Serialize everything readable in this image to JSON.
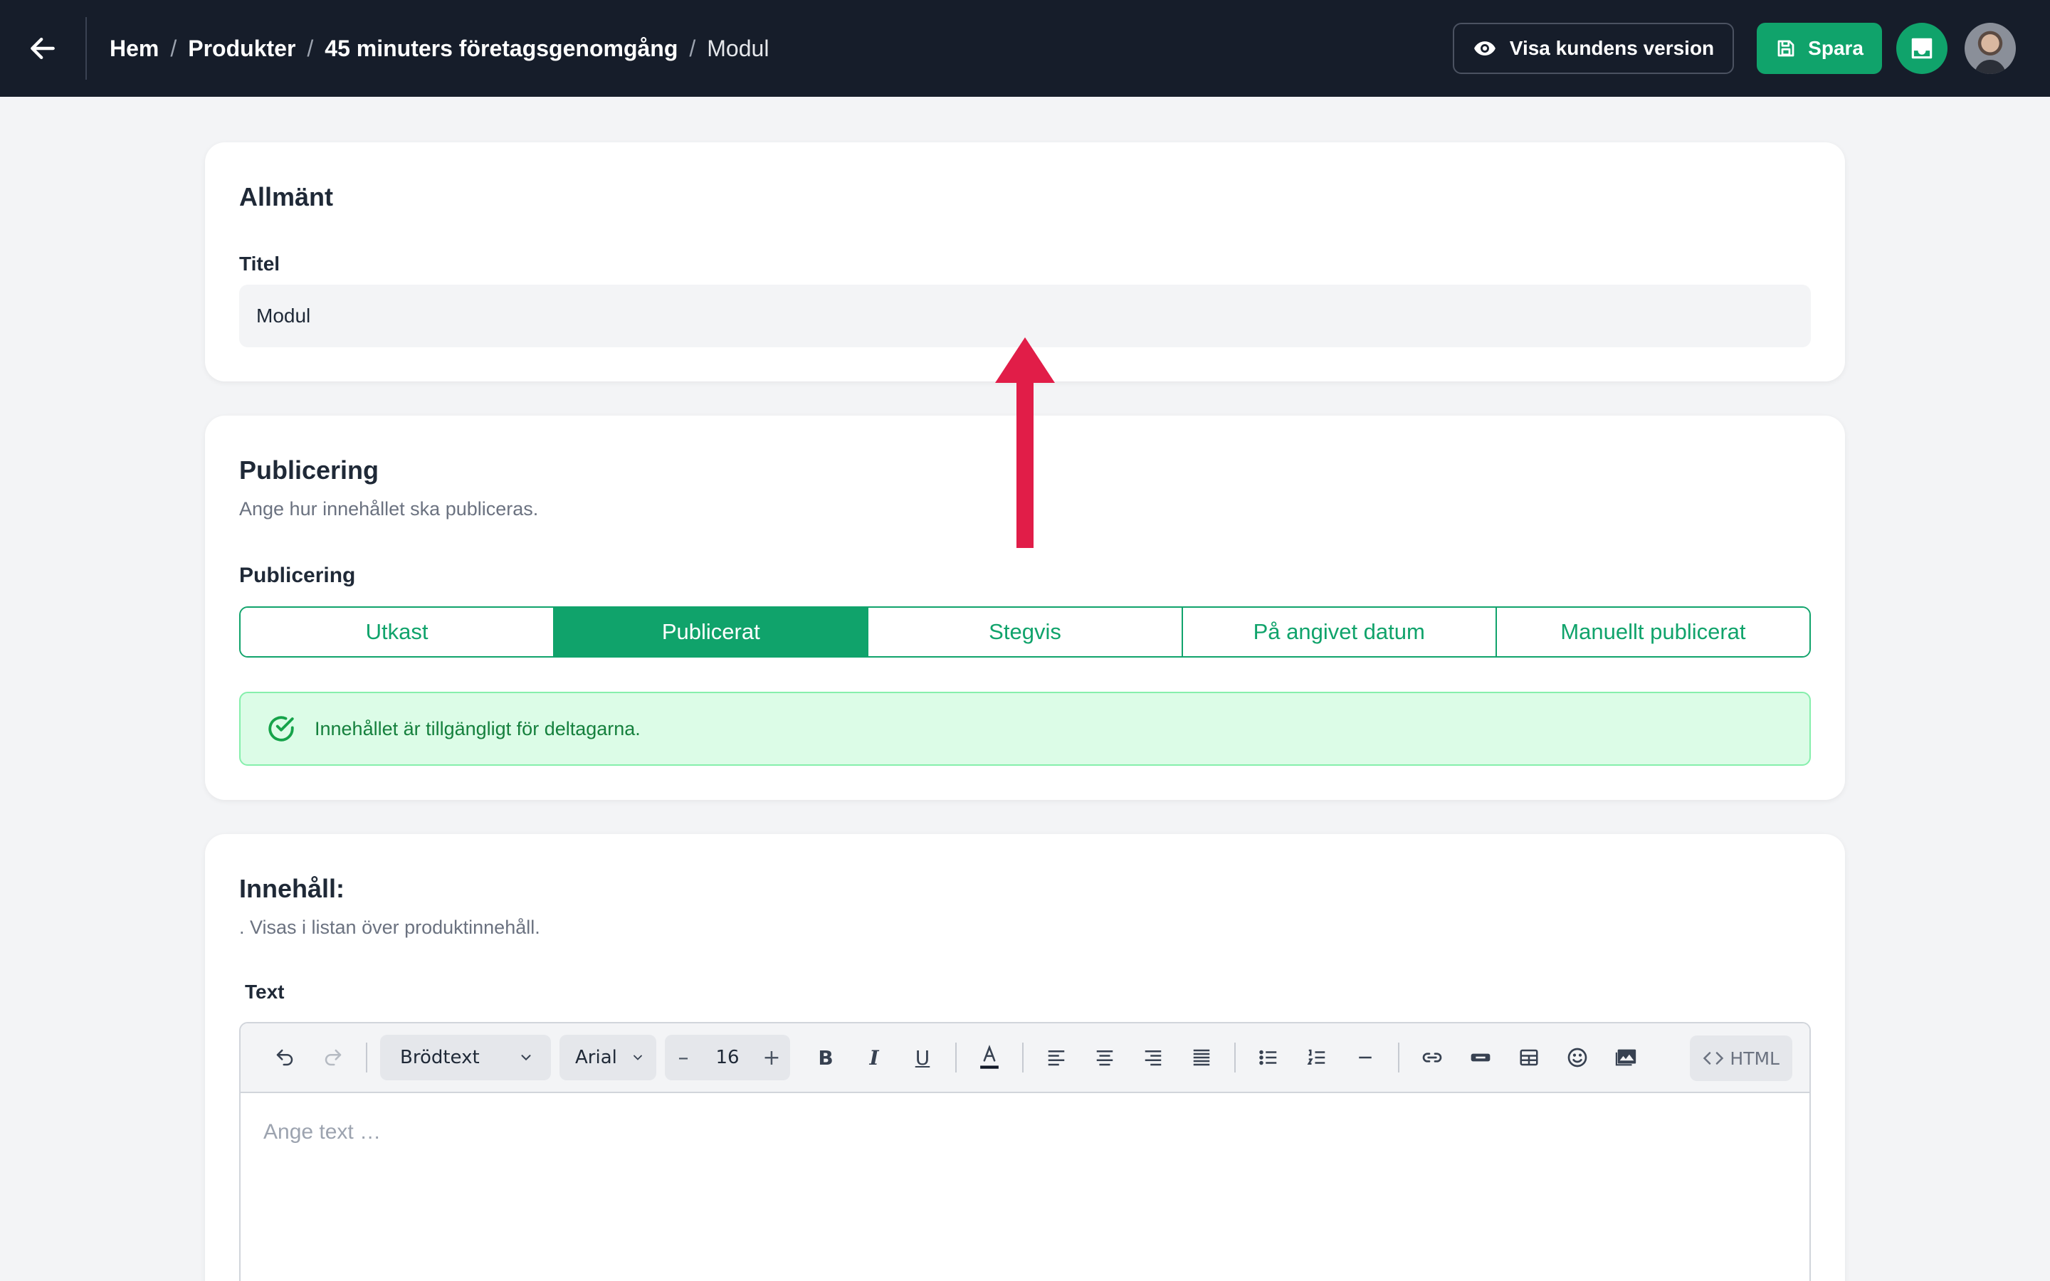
{
  "topbar": {
    "breadcrumb": [
      "Hem",
      "Produkter",
      "45 minuters företagsgenomgång"
    ],
    "current": "Modul",
    "separator": "/",
    "preview_label": "Visa kundens version",
    "save_label": "Spara"
  },
  "general": {
    "title": "Allmänt",
    "title_label": "Titel",
    "title_value": "Modul"
  },
  "publishing": {
    "title": "Publicering",
    "subtitle": "Ange hur innehållet ska publiceras.",
    "field_label": "Publicering",
    "options": [
      "Utkast",
      "Publicerat",
      "Stegvis",
      "På angivet datum",
      "Manuellt publicerat"
    ],
    "selected": "Publicerat",
    "status_text": "Innehållet är tillgängligt för deltagarna."
  },
  "content": {
    "title": "Innehåll:",
    "subtitle": ". Visas i listan över produktinnehåll.",
    "text_label": "Text",
    "editor": {
      "block_format": "Brödtext",
      "font": "Arial",
      "font_size": "16",
      "html_label": "HTML",
      "placeholder": "Ange text …"
    }
  },
  "colors": {
    "topbar_bg": "#161d2a",
    "accent_green": "#10a36b",
    "arrow_red": "#e11d48",
    "success_bg": "#dcfce7"
  },
  "icons": [
    "arrow-left-icon",
    "eye-icon",
    "save-icon",
    "inbox-icon",
    "undo-icon",
    "redo-icon",
    "chevron-down-icon",
    "bold-icon",
    "italic-icon",
    "underline-icon",
    "text-color-icon",
    "align-left-icon",
    "align-center-icon",
    "align-right-icon",
    "align-justify-icon",
    "bullet-list-icon",
    "numbered-list-icon",
    "horizontal-rule-icon",
    "link-icon",
    "embed-icon",
    "table-icon",
    "emoji-icon",
    "image-icon",
    "code-icon",
    "check-circle-icon"
  ]
}
